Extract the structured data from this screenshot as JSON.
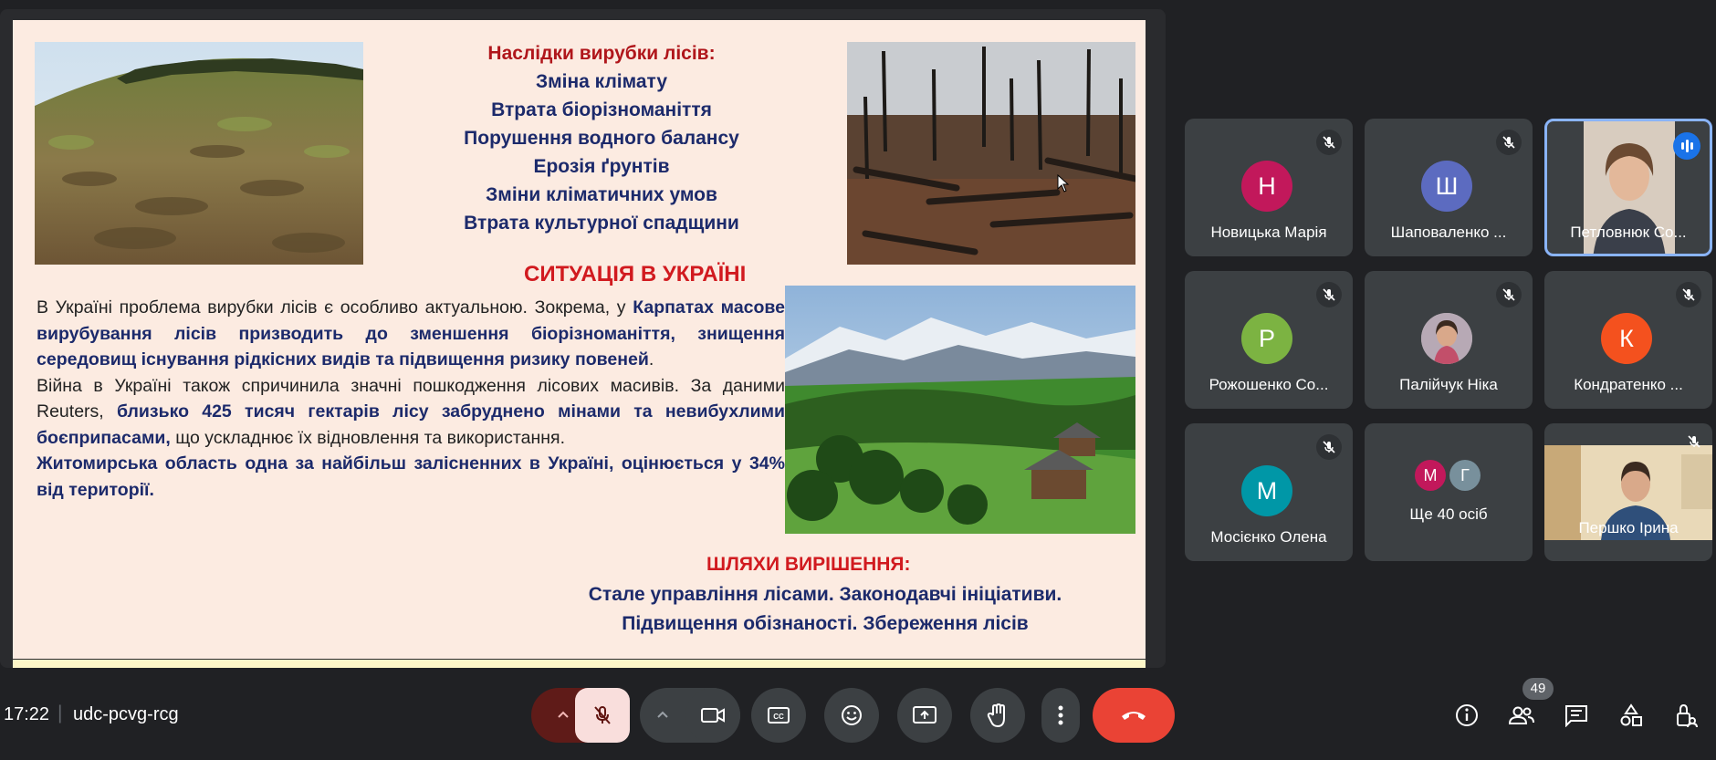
{
  "slide": {
    "consequences_title": "Наслідки вирубки лісів:",
    "consequences": [
      "Зміна клімату",
      "Втрата біорізноманіття",
      "Порушення водного балансу",
      "Ерозія ґрунтів",
      "Зміни кліматичних умов",
      "Втрата культурної спадщини"
    ],
    "situation_title": "СИТУАЦІЯ В УКРАЇНІ",
    "p1_normal": "В Україні проблема вирубки лісів є особливо актуальною. Зокрема, у ",
    "p1_bold": "Карпатах масове вирубування лісів призводить до зменшення біорізноманіття, знищення середовищ існування рідкісних видів та підвищення ризику повеней",
    "p1_end": ".",
    "p2_start": "Війна в Україні також спричинила значні пошкодження лісових масивів. За даними Reuters, ",
    "p2_bold": "близько 425 тисяч гектарів лісу забруднено мінами та невибухлими боєприпасами,",
    "p2_end": " що ускладнює їх відновлення та використання.",
    "p3_bold": "Житомирська область одна за найбільш залісненних в Україні, оцінюється у 34% від території.",
    "solutions_title": "ШЛЯХИ ВИРІШЕННЯ:",
    "solutions_line1": "Стале управління лісами. Законодавчі ініціативи.",
    "solutions_line2": "Підвищення обізнаності. Збереження лісів"
  },
  "participants": [
    {
      "initial": "Н",
      "name": "Новицька Марія",
      "color": "#c2185b"
    },
    {
      "initial": "Ш",
      "name": "Шаповаленко ...",
      "color": "#5c6bc0"
    },
    {
      "initial": "",
      "name": "Петловнюк Со...",
      "color": "#8d6e63"
    },
    {
      "initial": "Р",
      "name": "Рожошенко Со...",
      "color": "#7cb342"
    },
    {
      "initial": "",
      "name": "Палійчук Ніка",
      "color": "#9e9e9e"
    },
    {
      "initial": "К",
      "name": "Кондратенко ...",
      "color": "#f4511e"
    },
    {
      "initial": "М",
      "name": "Мосієнко Олена",
      "color": "#0097a7"
    },
    {
      "initial": "",
      "name": "Ще 40 осіб",
      "color": "#3c4043"
    },
    {
      "initial": "",
      "name": "Першко Ірина",
      "color": "#8d6e63"
    }
  ],
  "more_avatars": [
    "М",
    "Г"
  ],
  "more_avatar_colors": [
    "#c2185b",
    "#78909c"
  ],
  "meeting": {
    "time": "17:22",
    "separator": "|",
    "code": "udc-pcvg-rcg"
  },
  "people_count": "49",
  "colors": {
    "end_call": "#ea4335",
    "mic_off_bg": "#f9dedc",
    "mic_toggle_bg": "#5f1b18",
    "speaking": "#1a73e8"
  }
}
